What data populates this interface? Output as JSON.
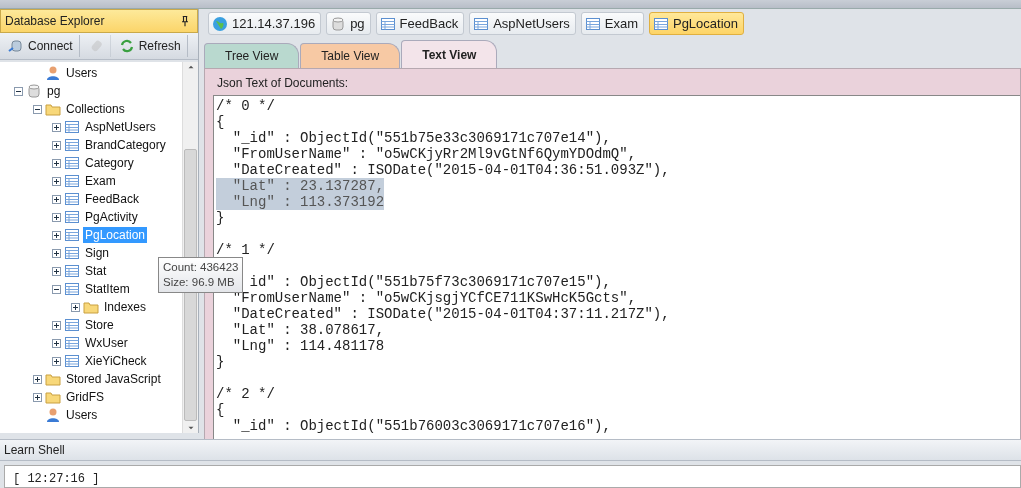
{
  "explorer": {
    "title": "Database Explorer",
    "toolbar": [
      {
        "kind": "connect",
        "label": "Connect",
        "disabled": false
      },
      {
        "kind": "disconnect",
        "disabled": true
      },
      {
        "kind": "refresh",
        "label": "Refresh",
        "disabled": false
      }
    ],
    "tree": [
      {
        "children": [
          {
            "label": "Users",
            "kind": "users",
            "selected": false
          }
        ]
      },
      {
        "label": "pg",
        "kind": "database",
        "expanded": true,
        "selected": false,
        "children": [
          {
            "label": "Collections",
            "kind": "folder",
            "expanded": true,
            "selected": false,
            "children": [
              {
                "label": "AspNetUsers",
                "kind": "collection",
                "expanded": false,
                "selected": false
              },
              {
                "label": "BrandCategory",
                "kind": "collection",
                "expanded": false,
                "selected": false
              },
              {
                "label": "Category",
                "kind": "collection",
                "expanded": false,
                "selected": false
              },
              {
                "label": "Exam",
                "kind": "collection",
                "expanded": false,
                "selected": false
              },
              {
                "label": "FeedBack",
                "kind": "collection",
                "expanded": false,
                "selected": false
              },
              {
                "label": "PgActivity",
                "kind": "collection",
                "expanded": false,
                "selected": false
              },
              {
                "label": "PgLocation",
                "kind": "collection",
                "expanded": false,
                "selected": true
              },
              {
                "label": "Sign",
                "kind": "collection",
                "expanded": false,
                "selected": false
              },
              {
                "label": "Stat",
                "kind": "collection",
                "expanded": false,
                "selected": false
              },
              {
                "label": "StatItem",
                "kind": "collection",
                "expanded": true,
                "selected": false,
                "children": [
                  {
                    "label": "Indexes",
                    "kind": "folder",
                    "expanded": false,
                    "selected": false
                  }
                ]
              },
              {
                "label": "Store",
                "kind": "collection",
                "expanded": false,
                "selected": false
              },
              {
                "label": "WxUser",
                "kind": "collection",
                "expanded": false,
                "selected": false
              },
              {
                "label": "XieYiCheck",
                "kind": "collection",
                "expanded": false,
                "selected": false
              }
            ]
          },
          {
            "label": "Stored JavaScript",
            "kind": "folder",
            "expanded": false,
            "selected": false
          },
          {
            "label": "GridFS",
            "kind": "folder",
            "expanded": false,
            "selected": false
          },
          {
            "label": "Users",
            "kind": "users",
            "selected": false
          }
        ]
      }
    ],
    "tooltip": [
      "Count: 436423",
      "Size: 96.9 MB"
    ]
  },
  "breadcrumbs": [
    {
      "label": "121.14.37.196",
      "kind": "server",
      "selected": false
    },
    {
      "label": "pg",
      "kind": "database",
      "selected": false
    },
    {
      "label": "FeedBack",
      "kind": "collection",
      "selected": false
    },
    {
      "label": "AspNetUsers",
      "kind": "collection",
      "selected": false
    },
    {
      "label": "Exam",
      "kind": "collection",
      "selected": false
    },
    {
      "label": "PgLocation",
      "kind": "collection",
      "selected": true
    }
  ],
  "tabs": [
    {
      "label": "Tree View",
      "color": "#b9d9cf",
      "selected": false
    },
    {
      "label": "Table View",
      "color": "#f7c9a4",
      "selected": false
    },
    {
      "label": "Text View",
      "color": "#f3e4ea",
      "selected": true
    }
  ],
  "document_panel": {
    "label": "Json Text of Documents:",
    "documents": [
      {
        "lines": [
          {
            "text": "/* 0 */",
            "highlighted": false
          },
          {
            "text": "{",
            "highlighted": false
          },
          {
            "text": "  \"_id\" : ObjectId(\"551b75e33c3069171c707e14\"),",
            "highlighted": false
          },
          {
            "text": "  \"FromUserName\" : \"o5wCKjyRr2Ml9vGtNf6QymYDOdmQ\",",
            "highlighted": false
          },
          {
            "text": "  \"DateCreated\" : ISODate(\"2015-04-01T04:36:51.093Z\"),",
            "highlighted": false
          },
          {
            "text": "  \"Lat\" : 23.137287,",
            "highlighted": true
          },
          {
            "text": "  \"Lng\" : 113.373192",
            "highlighted": true
          },
          {
            "text": "}",
            "highlighted": false
          }
        ]
      },
      {
        "lines": [
          {
            "text": "/* 1 */",
            "highlighted": false
          },
          {
            "kind": "covered"
          },
          {
            "kind": "partial",
            "text": "id\" : ObjectId(\"551b75f73c3069171c707e15\"),",
            "highlighted": false
          },
          {
            "text": "  \"FromUserName\" : \"o5wCKjsgjYCfCE711KSwHcK5Gcts\",",
            "highlighted": false
          },
          {
            "text": "  \"DateCreated\" : ISODate(\"2015-04-01T04:37:11.217Z\"),",
            "highlighted": false
          },
          {
            "text": "  \"Lat\" : 38.078617,",
            "highlighted": false
          },
          {
            "text": "  \"Lng\" : 114.481178",
            "highlighted": false
          },
          {
            "text": "}",
            "highlighted": false
          }
        ]
      },
      {
        "lines": [
          {
            "text": "/* 2 */",
            "highlighted": false
          },
          {
            "text": "{",
            "highlighted": false
          },
          {
            "text": "  \"_id\" : ObjectId(\"551b76003c3069171c707e16\"),",
            "highlighted": false
          }
        ]
      }
    ]
  },
  "shell": {
    "title": "Learn Shell",
    "output": "[ 12:27:16 ]"
  }
}
